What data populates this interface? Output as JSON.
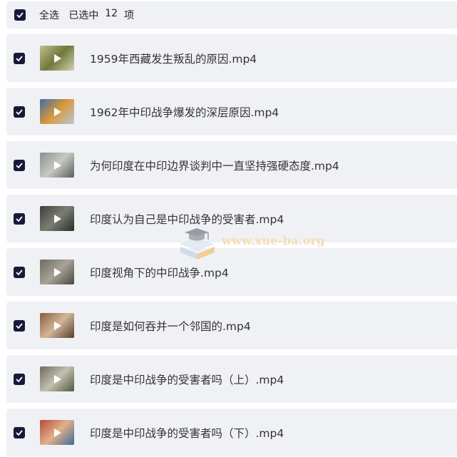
{
  "header": {
    "select_all_label": "全选",
    "selected_prefix": "已选中",
    "selected_count": "12",
    "selected_suffix": "项"
  },
  "files": [
    {
      "name": "1959年西藏发生叛乱的原因.mp4",
      "checked": true,
      "thumb_colors": [
        "#c9b98e",
        "#6e7a3a",
        "#d8cfb2"
      ]
    },
    {
      "name": "1962年中印战争爆发的深层原因.mp4",
      "checked": true,
      "thumb_colors": [
        "#3f6aa8",
        "#d99a3a",
        "#b7c5d8"
      ]
    },
    {
      "name": "为何印度在中印边界谈判中一直坚持强硬态度.mp4",
      "checked": true,
      "thumb_colors": [
        "#8a8f93",
        "#c7c9c4",
        "#5b5e5c"
      ]
    },
    {
      "name": "印度认为自己是中印战争的受害者.mp4",
      "checked": true,
      "thumb_colors": [
        "#3d3f3a",
        "#7b7f72",
        "#2a2c28"
      ]
    },
    {
      "name": "印度视角下的中印战争.mp4",
      "checked": true,
      "thumb_colors": [
        "#6f6a60",
        "#a8a396",
        "#4b4841"
      ]
    },
    {
      "name": "印度是如何吞并一个邻国的.mp4",
      "checked": true,
      "thumb_colors": [
        "#8e5b3e",
        "#d0b69a",
        "#5a3d2b"
      ]
    },
    {
      "name": "印度是中印战争的受害者吗（上）.mp4",
      "checked": true,
      "thumb_colors": [
        "#6d6a5d",
        "#c3c0b0",
        "#4f5a3c"
      ]
    },
    {
      "name": "印度是中印战争的受害者吗（下）.mp4",
      "checked": true,
      "thumb_colors": [
        "#b84a3a",
        "#e2b08a",
        "#3c6a9a"
      ]
    }
  ],
  "watermark": {
    "text": "www.xue-ba.org",
    "icon": "graduation-cap-book-icon"
  },
  "colors": {
    "row_bg": "#f0f1f4",
    "checkbox": "#161a3a",
    "text": "#333333",
    "watermark": "#f3d9a6"
  }
}
